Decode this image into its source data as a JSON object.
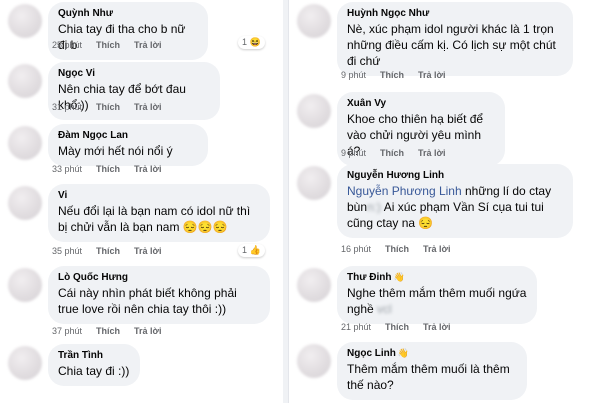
{
  "left": [
    {
      "name": "Quỳnh Như",
      "text": "Chia tay đi tha cho b nữ đi b",
      "time": "25 phút",
      "like": "Thích",
      "reply": "Trả lời",
      "reaction_count": "1",
      "reaction_emoji": "😆"
    },
    {
      "name": "Ngọc Vi",
      "text": "Nên chia tay để bớt đau khổ:))",
      "time": "31 phút",
      "like": "Thích",
      "reply": "Trả lời"
    },
    {
      "name": "Đàm Ngọc Lan",
      "text": "Mày mới hết nói nổi ý",
      "time": "33 phút",
      "like": "Thích",
      "reply": "Trả lời"
    },
    {
      "name": "Vi",
      "text": "Nếu đổi lại là bạn nam có idol nữ thì bị chửi vẫn là bạn nam 😔😔😔",
      "time": "35 phút",
      "like": "Thích",
      "reply": "Trả lời",
      "reaction_count": "1",
      "reaction_emoji": "👍"
    },
    {
      "name": "Lò Quốc Hưng",
      "text": "Cái này nhìn phát biết không phải true love rồi nên chia tay thôi :))",
      "time": "37 phút",
      "like": "Thích",
      "reply": "Trả lời"
    },
    {
      "name": "Trần Tình",
      "text": "Chia tay đi :))",
      "time": "",
      "like": "",
      "reply": ""
    }
  ],
  "right": [
    {
      "name": "Huỳnh Ngọc Như",
      "text": "Nè, xúc phạm idol người khác là 1 trọn những điều cấm kị. Có lịch sự một chút đi chứ",
      "time": "9 phút",
      "like": "Thích",
      "reply": "Trả lời"
    },
    {
      "name": "Xuân Vy",
      "text": "Khoe cho thiên hạ biết để vào chửi người yêu mình á?",
      "time": "9 phút",
      "like": "Thích",
      "reply": "Trả lời"
    },
    {
      "name": "Nguyễn Hương Linh",
      "tag": "Nguyễn Phương Linh",
      "text_a": " những lí do ctay",
      "text_b": "bùn",
      "blur_b": "n:)",
      "text_c": " Ai xúc phạm Vần Sí cụa tui tui cũng ctay na 😔",
      "time": "16 phút",
      "like": "Thích",
      "reply": "Trả lời"
    },
    {
      "name": "Thư Đinh",
      "badge": "👋",
      "text_a": "Nghe thêm mắm thêm muối ngứa nghề",
      "blur_a": "vcl",
      "time": "21 phút",
      "like": "Thích",
      "reply": "Trả lời"
    },
    {
      "name": "Ngọc Linh",
      "badge": "👋",
      "text": "Thêm mắm thêm muối là thêm thế nào?",
      "time": "",
      "like": "",
      "reply": ""
    }
  ]
}
